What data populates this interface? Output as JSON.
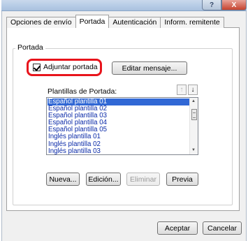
{
  "titlebar": {
    "help_label": "?",
    "close_label": "X"
  },
  "tabs": [
    {
      "label": "Opciones de envío"
    },
    {
      "label": "Portada"
    },
    {
      "label": "Autenticación"
    },
    {
      "label": "Inform. remitente"
    }
  ],
  "portada": {
    "group_title": "Portada",
    "attach_checkbox_label": "Adjuntar portada",
    "attach_checked": true,
    "edit_message_label": "Editar mensaje...",
    "templates_label": "Plantillas de Portada:",
    "sort_up_icon": "↑",
    "sort_down_icon": "↓",
    "templates": [
      "Español plantilla 01",
      "Español plantilla 02",
      "Español plantilla 03",
      "Español plantilla 04",
      "Español plantilla 05",
      "Inglés plantilla 01",
      "Inglés plantilla 02",
      "Inglés plantilla 03"
    ],
    "selected_index": 0,
    "new_label": "Nueva...",
    "edit_label": "Edición...",
    "delete_label": "Eliminar",
    "preview_label": "Previa"
  },
  "footer": {
    "accept_label": "Aceptar",
    "cancel_label": "Cancelar"
  },
  "colors": {
    "highlight": "#e8141c",
    "selection": "#3168d5",
    "list_text": "#0a2aa8"
  }
}
